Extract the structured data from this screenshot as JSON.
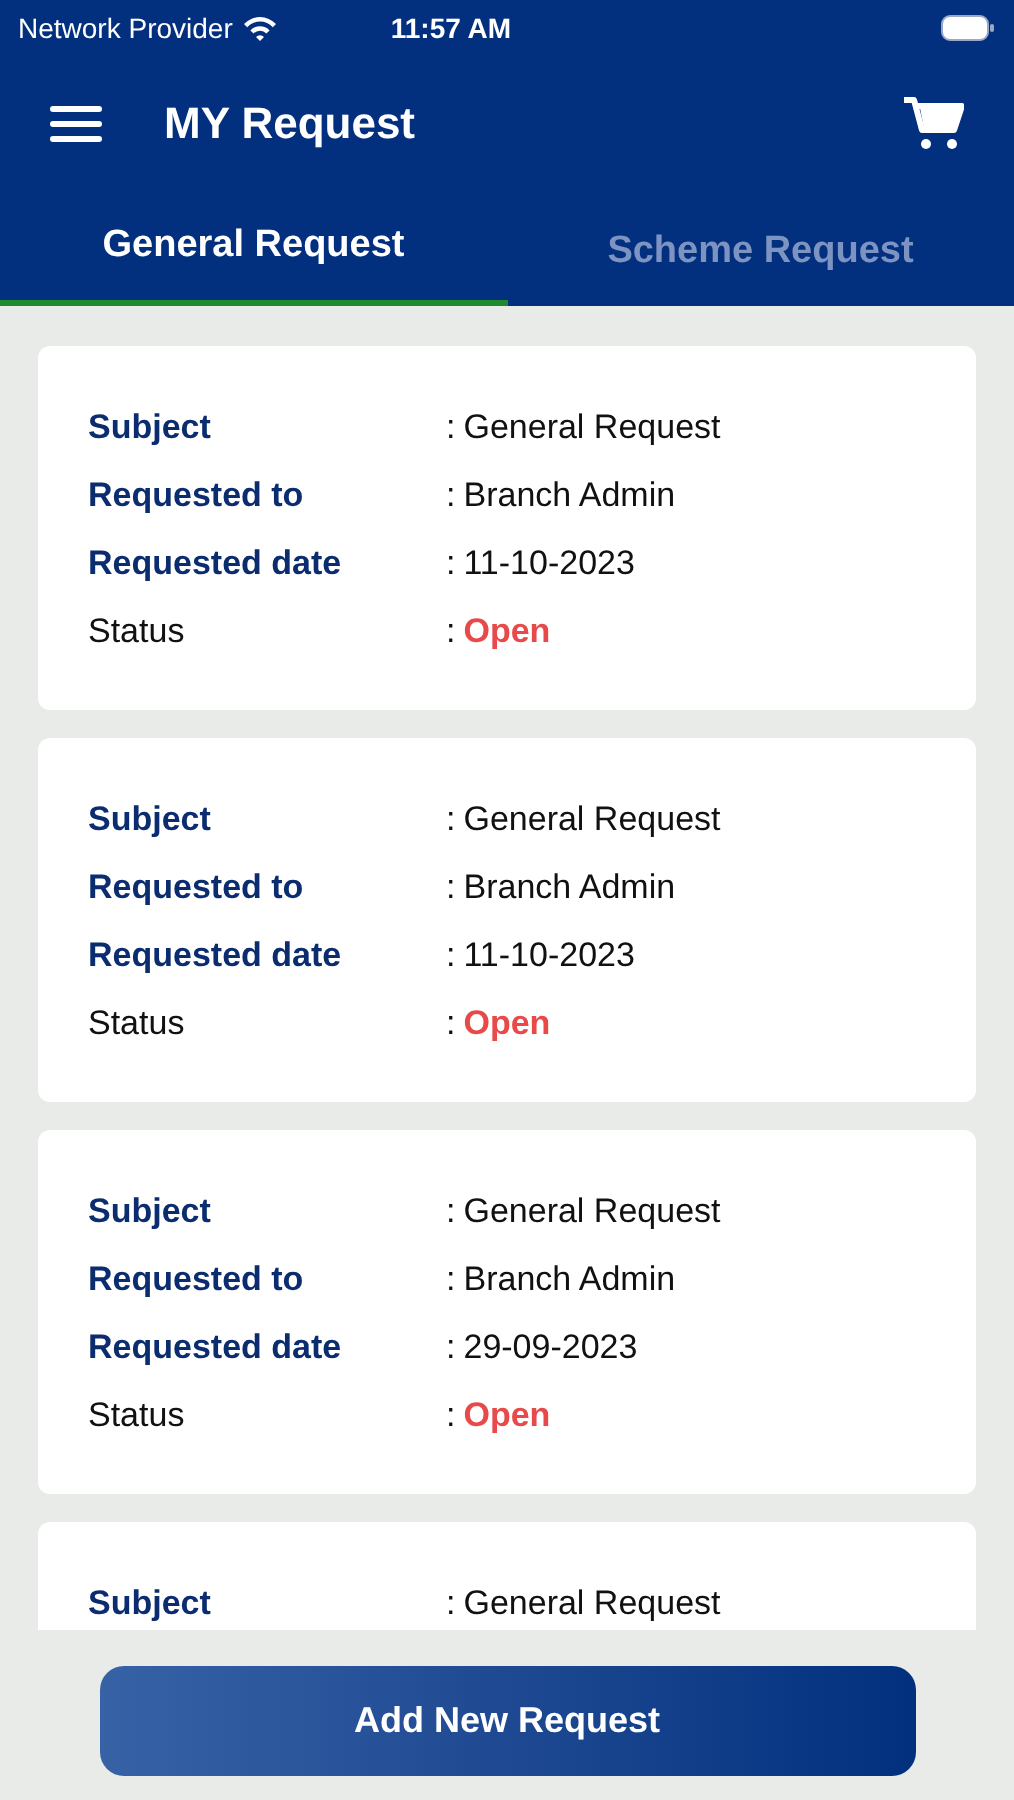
{
  "status_bar": {
    "carrier": "Network Provider",
    "time": "11:57 AM"
  },
  "header": {
    "title": "MY Request"
  },
  "tabs": [
    {
      "label": "General Request",
      "selected": true
    },
    {
      "label": "Scheme Request",
      "selected": false
    }
  ],
  "requests": [
    {
      "rows": [
        {
          "kind": "field",
          "label": "Subject",
          "separator": ":",
          "value": "General Request"
        },
        {
          "kind": "field",
          "label": "Requested to",
          "separator": ":",
          "value": "Branch Admin"
        },
        {
          "kind": "field",
          "label": "Requested date",
          "separator": ":",
          "value": "11-10-2023"
        },
        {
          "kind": "status",
          "label": "Status",
          "separator": ":",
          "value": "Open"
        }
      ]
    },
    {
      "rows": [
        {
          "kind": "field",
          "label": "Subject",
          "separator": ":",
          "value": "General Request"
        },
        {
          "kind": "field",
          "label": "Requested to",
          "separator": ":",
          "value": "Branch Admin"
        },
        {
          "kind": "field",
          "label": "Requested date",
          "separator": ":",
          "value": "11-10-2023"
        },
        {
          "kind": "status",
          "label": "Status",
          "separator": ":",
          "value": "Open"
        }
      ]
    },
    {
      "rows": [
        {
          "kind": "field",
          "label": "Subject",
          "separator": ":",
          "value": "General Request"
        },
        {
          "kind": "field",
          "label": "Requested to",
          "separator": ":",
          "value": "Branch Admin"
        },
        {
          "kind": "field",
          "label": "Requested date",
          "separator": ":",
          "value": "29-09-2023"
        },
        {
          "kind": "status",
          "label": "Status",
          "separator": ":",
          "value": "Open"
        }
      ]
    },
    {
      "rows": [
        {
          "kind": "field",
          "label": "Subject",
          "separator": ":",
          "value": "General Request"
        }
      ]
    }
  ],
  "add_button": "Add New Request"
}
